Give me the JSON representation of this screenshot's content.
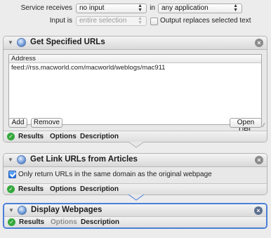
{
  "service": {
    "receives_label": "Service receives",
    "receives_value": "no input",
    "in_label": "in",
    "app_value": "any application",
    "input_is_label": "Input is",
    "input_is_value": "entire selection",
    "replaces_label": "Output replaces selected text",
    "replaces_checked": false
  },
  "footer_tabs": {
    "results": "Results",
    "options": "Options",
    "description": "Description"
  },
  "actions": [
    {
      "title": "Get Specified URLs",
      "table_header": "Address",
      "rows": [
        "feed://rss.macworld.com/macworld/weblogs/mac911"
      ],
      "buttons": {
        "add": "Add",
        "remove": "Remove",
        "open": "Open URL"
      },
      "options_enabled": true
    },
    {
      "title": "Get Link URLs from Articles",
      "checkbox_label": "Only return URLs in the same domain as the original webpage",
      "checkbox_checked": true,
      "options_enabled": true
    },
    {
      "title": "Display Webpages",
      "options_enabled": false,
      "selected": true
    }
  ],
  "icons": {
    "collapse": "disclosure-triangle-icon",
    "action": "automator-action-icon",
    "close": "close-icon",
    "status": "checkmark-icon"
  },
  "colors": {
    "selection": "#4a7fd8",
    "status_ok": "#35a83c",
    "checkbox": "#1f6fe0"
  }
}
